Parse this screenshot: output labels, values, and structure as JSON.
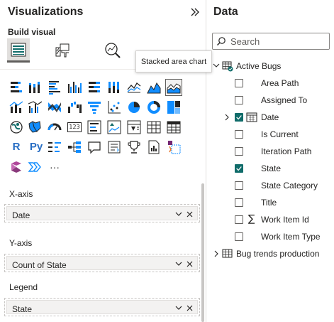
{
  "viz_pane": {
    "title": "Visualizations",
    "build_visual_label": "Build visual",
    "tooltip": "Stacked area chart",
    "more_label": "···",
    "r_label": "R",
    "py_label": "Py",
    "kpi_label": "123",
    "fields": {
      "xaxis": {
        "label": "X-axis",
        "value": "Date"
      },
      "yaxis": {
        "label": "Y-axis",
        "value": "Count of State"
      },
      "legend": {
        "label": "Legend",
        "value": "State"
      }
    }
  },
  "data_pane": {
    "title": "Data",
    "search_placeholder": "Search",
    "tables": [
      {
        "name": "Active Bugs",
        "expanded": true
      },
      {
        "name": "Bug trends production",
        "expanded": false
      }
    ],
    "fields": [
      {
        "name": "Area Path",
        "checked": false
      },
      {
        "name": "Assigned To",
        "checked": false
      },
      {
        "name": "Date",
        "checked": true
      },
      {
        "name": "Is Current",
        "checked": false
      },
      {
        "name": "Iteration Path",
        "checked": false
      },
      {
        "name": "State",
        "checked": true
      },
      {
        "name": "State Category",
        "checked": false
      },
      {
        "name": "Title",
        "checked": false
      },
      {
        "name": "Work Item Id",
        "checked": false
      },
      {
        "name": "Work Item Type",
        "checked": false
      }
    ]
  },
  "colors": {
    "accent": "#118dff",
    "teal": "#106c6a",
    "dark": "#252423"
  }
}
